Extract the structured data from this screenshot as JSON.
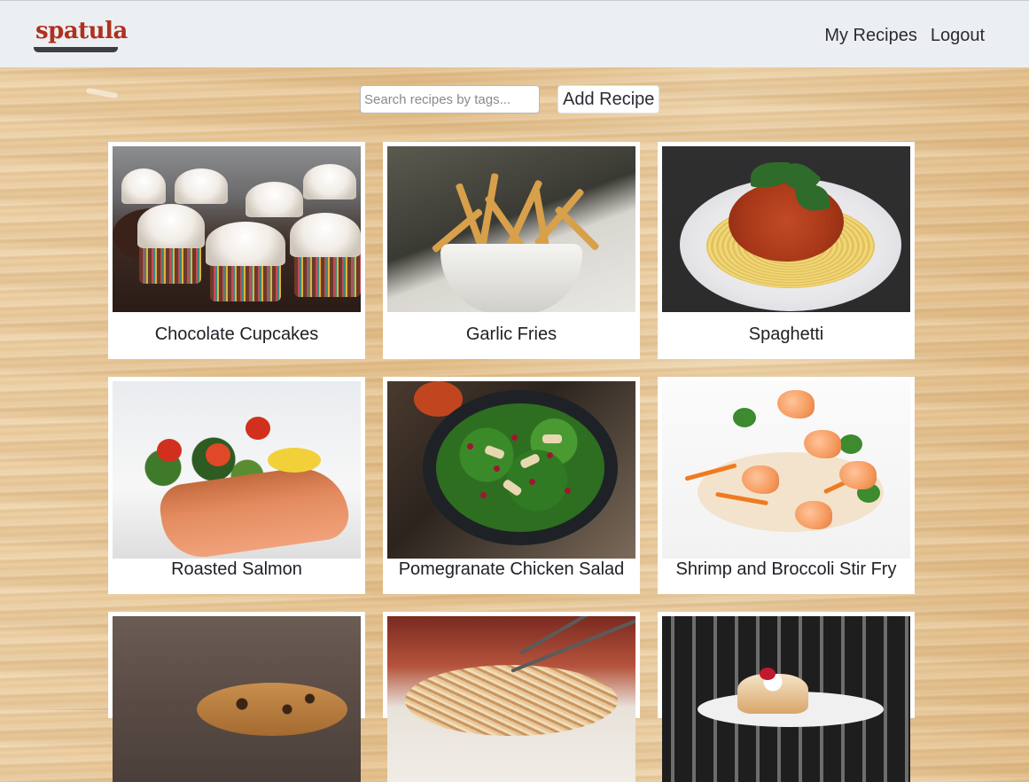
{
  "brand": {
    "logo_text": "spatula",
    "logo_color": "#b0301e"
  },
  "nav": {
    "my_recipes": "My Recipes",
    "logout": "Logout"
  },
  "toolbar": {
    "search_placeholder": "Search recipes by tags...",
    "search_value": "",
    "add_recipe": "Add Recipe"
  },
  "recipes": [
    {
      "title": "Chocolate Cupcakes",
      "image": "cupcakes-photo"
    },
    {
      "title": "Garlic Fries",
      "image": "fries-photo"
    },
    {
      "title": "Spaghetti",
      "image": "spaghetti-photo"
    },
    {
      "title": "Roasted Salmon",
      "image": "salmon-photo"
    },
    {
      "title": "Pomegranate Chicken Salad",
      "image": "salad-photo"
    },
    {
      "title": "Shrimp and Broccoli Stir Fry",
      "image": "shrimp-photo"
    },
    {
      "title": "",
      "image": "cookie-photo"
    },
    {
      "title": "",
      "image": "noodles-photo"
    },
    {
      "title": "",
      "image": "dessert-photo"
    }
  ]
}
